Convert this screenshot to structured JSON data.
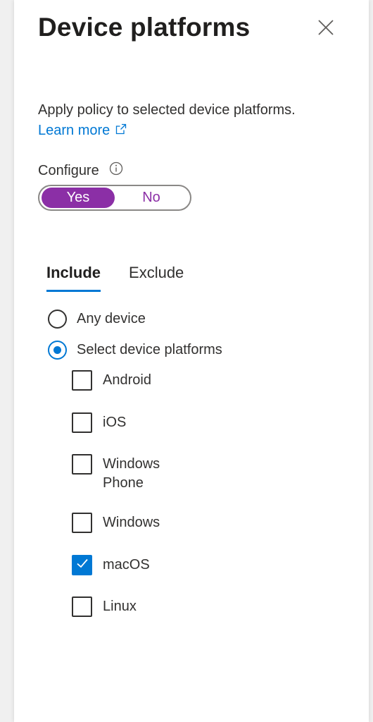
{
  "panel": {
    "title": "Device platforms",
    "close_icon": "close-icon"
  },
  "description": "Apply policy to selected device platforms.",
  "learn_more": {
    "label": "Learn more",
    "icon": "external-link-icon"
  },
  "configure": {
    "label": "Configure",
    "info_icon": "info-icon",
    "options": [
      "Yes",
      "No"
    ],
    "selected": "Yes",
    "accent_color": "#8b2fa6"
  },
  "tabs": [
    {
      "label": "Include",
      "active": true
    },
    {
      "label": "Exclude",
      "active": false
    }
  ],
  "device_scope": {
    "options": [
      {
        "label": "Any device",
        "checked": false
      },
      {
        "label": "Select device platforms",
        "checked": true
      }
    ]
  },
  "platforms": [
    {
      "label": "Android",
      "checked": false
    },
    {
      "label": "iOS",
      "checked": false
    },
    {
      "label": "Windows Phone",
      "checked": false
    },
    {
      "label": "Windows",
      "checked": false
    },
    {
      "label": "macOS",
      "checked": true
    },
    {
      "label": "Linux",
      "checked": false
    }
  ],
  "colors": {
    "link": "#0078d4",
    "check": "#0078d4"
  }
}
